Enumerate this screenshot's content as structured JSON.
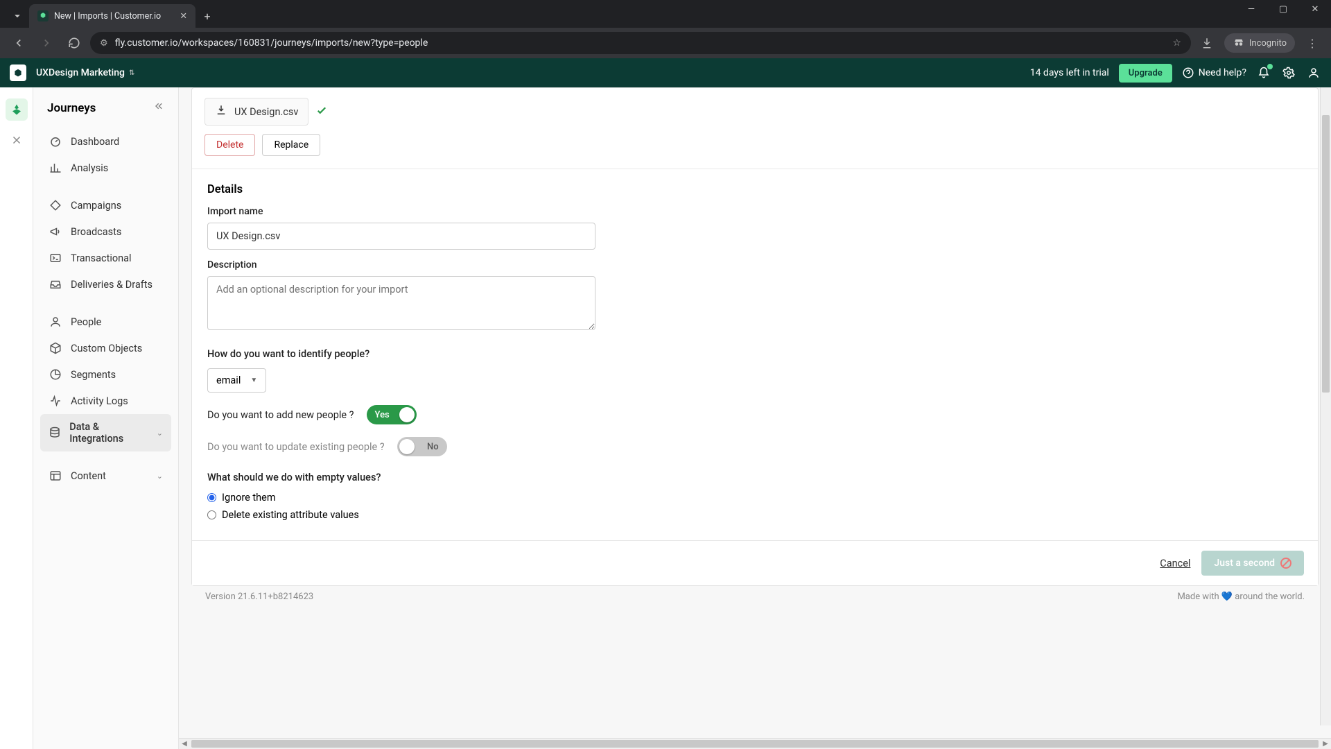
{
  "browser": {
    "tab_title": "New | Imports | Customer.io",
    "url": "fly.customer.io/workspaces/160831/journeys/imports/new?type=people",
    "incognito": "Incognito"
  },
  "header": {
    "workspace": "UXDesign Marketing",
    "trial": "14 days left in trial",
    "upgrade": "Upgrade",
    "help": "Need help?"
  },
  "sidebar": {
    "title": "Journeys",
    "items": [
      {
        "label": "Dashboard"
      },
      {
        "label": "Analysis"
      },
      {
        "label": "Campaigns"
      },
      {
        "label": "Broadcasts"
      },
      {
        "label": "Transactional"
      },
      {
        "label": "Deliveries & Drafts"
      },
      {
        "label": "People"
      },
      {
        "label": "Custom Objects"
      },
      {
        "label": "Segments"
      },
      {
        "label": "Activity Logs"
      },
      {
        "label": "Data & Integrations"
      },
      {
        "label": "Content"
      }
    ]
  },
  "file": {
    "name": "UX Design.csv",
    "delete": "Delete",
    "replace": "Replace"
  },
  "details": {
    "heading": "Details",
    "import_name_label": "Import name",
    "import_name_value": "UX Design.csv",
    "description_label": "Description",
    "description_placeholder": "Add an optional description for your import",
    "identify_q": "How do you want to identify people?",
    "identify_value": "email",
    "add_people_q": "Do you want to add new people ?",
    "add_people_toggle": "Yes",
    "update_people_q": "Do you want to update existing people ?",
    "update_people_toggle": "No",
    "empty_q": "What should we do with empty values?",
    "radio_ignore": "Ignore them",
    "radio_delete": "Delete existing attribute values"
  },
  "footer": {
    "cancel": "Cancel",
    "next": "Just a second",
    "version": "Version 21.6.11+b8214623",
    "made_with": "Made with 💙 around the world."
  }
}
